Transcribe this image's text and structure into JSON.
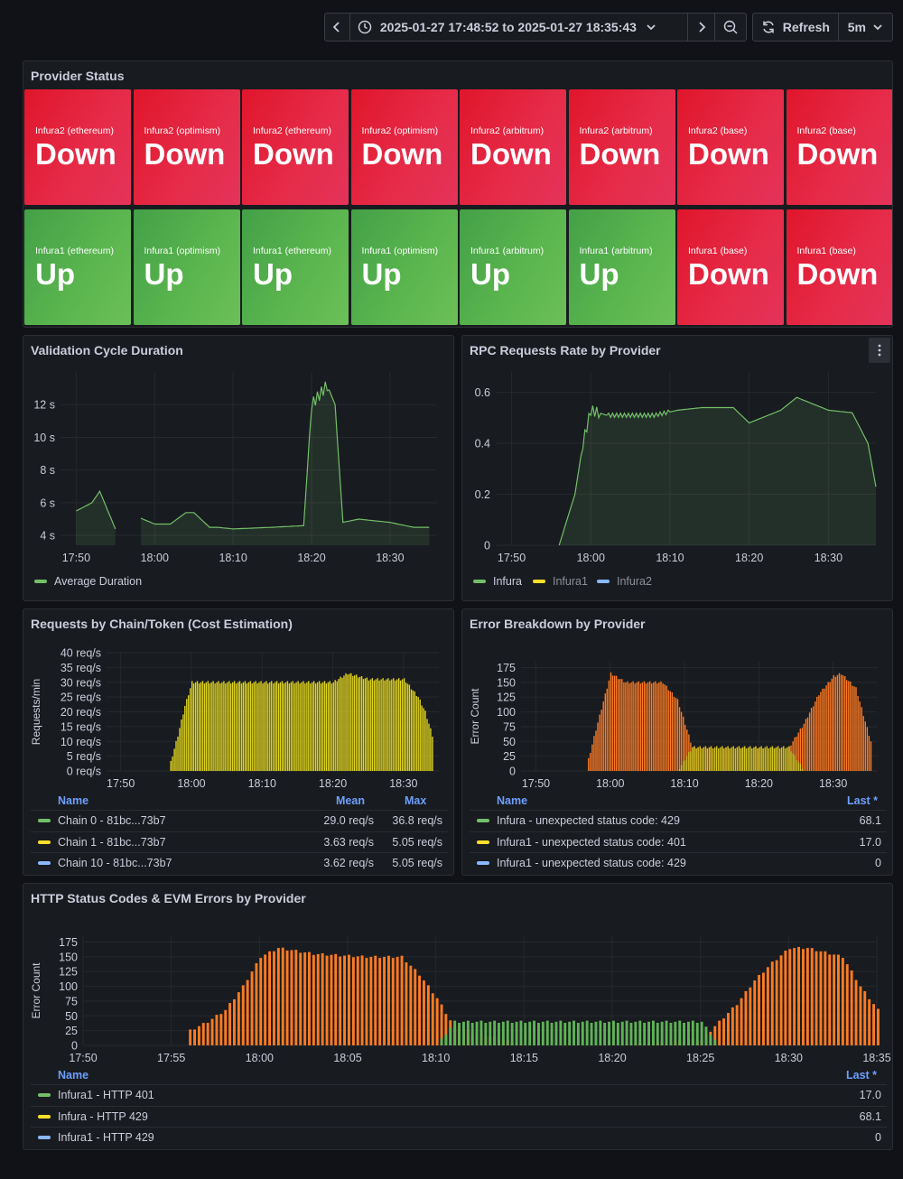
{
  "toolbar": {
    "time_range": "2025-01-27 17:48:52 to 2025-01-27 18:35:43",
    "refresh_label": "Refresh",
    "refresh_interval": "5m",
    "icons": [
      "chevron-left-icon",
      "clock-icon",
      "chevron-down-icon",
      "chevron-right-icon",
      "zoom-out-icon",
      "refresh-icon",
      "chevron-down-icon"
    ]
  },
  "provider_status": {
    "title": "Provider Status",
    "tiles": [
      {
        "name": "Infura2 (ethereum)",
        "value": "Down"
      },
      {
        "name": "Infura2 (optimism)",
        "value": "Down"
      },
      {
        "name": "Infura2 (ethereum)",
        "value": "Down"
      },
      {
        "name": "Infura2 (optimism)",
        "value": "Down"
      },
      {
        "name": "Infura2 (arbitrum)",
        "value": "Down"
      },
      {
        "name": "Infura2 (arbitrum)",
        "value": "Down"
      },
      {
        "name": "Infura2 (base)",
        "value": "Down"
      },
      {
        "name": "Infura2 (base)",
        "value": "Down"
      },
      {
        "name": "Infura1 (ethereum)",
        "value": "Up"
      },
      {
        "name": "Infura1 (optimism)",
        "value": "Up"
      },
      {
        "name": "Infura1 (ethereum)",
        "value": "Up"
      },
      {
        "name": "Infura1 (optimism)",
        "value": "Up"
      },
      {
        "name": "Infura1 (arbitrum)",
        "value": "Up"
      },
      {
        "name": "Infura1 (arbitrum)",
        "value": "Up"
      },
      {
        "name": "Infura1 (base)",
        "value": "Down"
      },
      {
        "name": "Infura1 (base)",
        "value": "Down"
      }
    ],
    "colors": {
      "down": "#e0162b",
      "up": "#56a64b"
    }
  },
  "validation": {
    "title": "Validation Cycle Duration",
    "legend": "Average Duration"
  },
  "rpc": {
    "title": "RPC Requests Rate by Provider",
    "legend": [
      "Infura",
      "Infura1",
      "Infura2"
    ]
  },
  "requests": {
    "title": "Requests by Chain/Token (Cost Estimation)",
    "ylabel": "Requests/min",
    "table": {
      "headers": [
        "Name",
        "Mean",
        "Max"
      ],
      "rows": [
        {
          "name": "Chain 0 - 81bc...73b7",
          "mean": "29.0 req/s",
          "max": "36.8 req/s",
          "color": "#73bf69"
        },
        {
          "name": "Chain 1 - 81bc...73b7",
          "mean": "3.63 req/s",
          "max": "5.05 req/s",
          "color": "#fade2a"
        },
        {
          "name": "Chain 10 - 81bc...73b7",
          "mean": "3.62 req/s",
          "max": "5.05 req/s",
          "color": "#8ab8ff"
        }
      ]
    }
  },
  "errors": {
    "title": "Error Breakdown by Provider",
    "ylabel": "Error Count",
    "table": {
      "headers": [
        "Name",
        "Last *"
      ],
      "rows": [
        {
          "name": "Infura - unexpected status code: 429",
          "last": "68.1",
          "color": "#73bf69"
        },
        {
          "name": "Infura1 - unexpected status code: 401",
          "last": "17.0",
          "color": "#fade2a"
        },
        {
          "name": "Infura1 - unexpected status code: 429",
          "last": "0",
          "color": "#8ab8ff"
        }
      ]
    }
  },
  "http": {
    "title": "HTTP Status Codes & EVM Errors by Provider",
    "ylabel": "Error Count",
    "table": {
      "headers": [
        "Name",
        "Last *"
      ],
      "rows": [
        {
          "name": "Infura1 - HTTP 401",
          "last": "17.0",
          "color": "#73bf69"
        },
        {
          "name": "Infura - HTTP 429",
          "last": "68.1",
          "color": "#fade2a"
        },
        {
          "name": "Infura1 - HTTP 429",
          "last": "0",
          "color": "#8ab8ff"
        }
      ]
    }
  },
  "chart_data": [
    {
      "type": "line",
      "title": "Validation Cycle Duration",
      "x": [
        "17:50",
        "17:52",
        "17:53",
        "17:55",
        "17:56",
        "17:58",
        "18:00",
        "18:02",
        "18:04",
        "18:05",
        "18:07",
        "18:08",
        "18:10",
        "18:15",
        "18:19",
        "18:20",
        "18:22",
        "18:23",
        "18:24",
        "18:26",
        "18:30",
        "18:33",
        "18:35"
      ],
      "series": [
        {
          "name": "Average Duration",
          "values": [
            5.5,
            6.0,
            6.7,
            4.4,
            null,
            5.1,
            4.7,
            4.7,
            5.4,
            5.4,
            4.5,
            4.5,
            4.4,
            4.5,
            4.6,
            12.0,
            13.2,
            12.0,
            4.8,
            5.0,
            4.8,
            4.5,
            4.5
          ]
        }
      ],
      "xticks": [
        "17:50",
        "18:00",
        "18:10",
        "18:20",
        "18:30"
      ],
      "yticks": [
        "4 s",
        "6 s",
        "8 s",
        "10 s",
        "12 s"
      ],
      "ylim": [
        3.4,
        14
      ],
      "color": "#73bf69"
    },
    {
      "type": "line",
      "title": "RPC Requests Rate by Provider",
      "x": [
        "17:56",
        "17:58",
        "17:59",
        "18:00",
        "18:02",
        "18:05",
        "18:08",
        "18:11",
        "18:14",
        "18:18",
        "18:20",
        "18:24",
        "18:26",
        "18:30",
        "18:33",
        "18:35",
        "18:36"
      ],
      "series": [
        {
          "name": "Infura",
          "values": [
            0,
            0.2,
            0.4,
            0.53,
            0.51,
            0.51,
            0.51,
            0.53,
            0.54,
            0.54,
            0.48,
            0.53,
            0.58,
            0.53,
            0.52,
            0.4,
            0.23
          ]
        },
        {
          "name": "Infura1",
          "values": []
        },
        {
          "name": "Infura2",
          "values": []
        }
      ],
      "xticks": [
        "17:50",
        "18:00",
        "18:10",
        "18:20",
        "18:30"
      ],
      "yticks": [
        "0",
        "0.2",
        "0.4",
        "0.6"
      ],
      "ylim": [
        0,
        0.68
      ]
    },
    {
      "type": "bar",
      "title": "Requests by Chain/Token (Cost Estimation)",
      "ylabel": "Requests/min",
      "x": [
        "17:57",
        "17:58",
        "17:59",
        "18:00",
        "18:05",
        "18:10",
        "18:15",
        "18:20",
        "18:22",
        "18:25",
        "18:30",
        "18:32",
        "18:33",
        "18:34"
      ],
      "series": [
        {
          "name": "Chain 0 - 81bc...73b7",
          "values": [
            3,
            12,
            22,
            30,
            30,
            30,
            30,
            30,
            33,
            31,
            31,
            25,
            20,
            12
          ]
        }
      ],
      "xticks": [
        "17:50",
        "18:00",
        "18:10",
        "18:20",
        "18:30"
      ],
      "yticks": [
        "0 req/s",
        "5 req/s",
        "10 req/s",
        "15 req/s",
        "20 req/s",
        "25 req/s",
        "30 req/s",
        "35 req/s",
        "40 req/s"
      ],
      "ylim": [
        0,
        40
      ]
    },
    {
      "type": "bar",
      "title": "Error Breakdown by Provider",
      "ylabel": "Error Count",
      "x": [
        "17:57",
        "17:58",
        "18:00",
        "18:02",
        "18:05",
        "18:07",
        "18:09",
        "18:11",
        "18:15",
        "18:20",
        "18:24",
        "18:26",
        "18:28",
        "18:30",
        "18:31",
        "18:33",
        "18:35"
      ],
      "series": [
        {
          "name": "Infura - unexpected status code: 429",
          "values": [
            20,
            70,
            165,
            150,
            150,
            150,
            120,
            40,
            40,
            40,
            40,
            80,
            130,
            160,
            165,
            140,
            50
          ]
        },
        {
          "name": "Infura1 - unexpected status code: 401",
          "values": [
            0,
            0,
            0,
            0,
            0,
            0,
            0,
            40,
            40,
            40,
            40,
            0,
            0,
            0,
            0,
            0,
            0
          ]
        }
      ],
      "xticks": [
        "17:50",
        "18:00",
        "18:10",
        "18:20",
        "18:30"
      ],
      "yticks": [
        "0",
        "25",
        "50",
        "75",
        "100",
        "125",
        "150",
        "175"
      ],
      "ylim": [
        0,
        185
      ]
    },
    {
      "type": "bar",
      "title": "HTTP Status Codes & EVM Errors by Provider",
      "ylabel": "Error Count",
      "x": [
        "17:56",
        "17:57",
        "17:58",
        "17:59",
        "18:00",
        "18:01",
        "18:03",
        "18:06",
        "18:08",
        "18:09",
        "18:10",
        "18:11",
        "18:15",
        "18:20",
        "18:25",
        "18:26",
        "18:27",
        "18:28",
        "18:29",
        "18:30",
        "18:31",
        "18:33",
        "18:34",
        "18:35"
      ],
      "series": [
        {
          "name": "Infura - HTTP 429",
          "values": [
            25,
            40,
            60,
            100,
            150,
            165,
            155,
            150,
            150,
            120,
            80,
            30,
            0,
            0,
            10,
            40,
            70,
            110,
            140,
            165,
            165,
            150,
            100,
            60
          ]
        },
        {
          "name": "Infura1 - HTTP 401",
          "values": [
            0,
            0,
            0,
            0,
            0,
            0,
            0,
            0,
            0,
            0,
            0,
            40,
            40,
            40,
            40,
            0,
            0,
            0,
            0,
            0,
            0,
            0,
            0,
            0
          ]
        }
      ],
      "xticks": [
        "17:50",
        "17:55",
        "18:00",
        "18:05",
        "18:10",
        "18:15",
        "18:20",
        "18:25",
        "18:30",
        "18:35"
      ],
      "yticks": [
        "0",
        "25",
        "50",
        "75",
        "100",
        "125",
        "150",
        "175"
      ],
      "ylim": [
        0,
        185
      ]
    }
  ]
}
